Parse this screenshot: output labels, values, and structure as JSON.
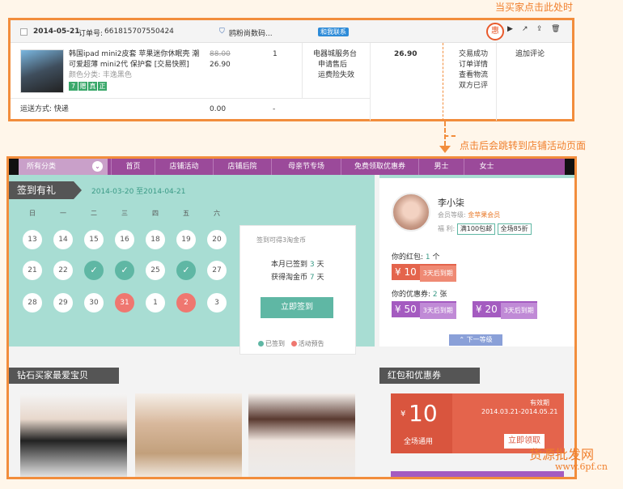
{
  "annotation_top": "当买家点击此处时",
  "annotation_mid": "点击后会跳转到店铺活动页面",
  "order": {
    "date": "2014-05-21",
    "order_no_label": "订单号:",
    "order_no": "661815707550424",
    "shop_name": "鸥粉尚数码...",
    "contact_label": "和我联系",
    "promo_icon_label": "惠",
    "product_title_lines": [
      "韩国ipad mini2皮套 苹果迷你休眠壳 潮",
      "可爱超薄 mini2代 保护套 [交易快照]"
    ],
    "color_label": "颜色分类: 丰逸黑色",
    "badges": [
      "7",
      "赠",
      "真",
      "正"
    ],
    "price_original": "88.00",
    "price_now": "26.90",
    "quantity": "1",
    "service_lines": [
      "电器城服务台",
      "申请售后",
      "运费险失效"
    ],
    "total": "26.90",
    "status_lines": [
      "交易成功",
      "订单详情",
      "查看物流",
      "双方已评"
    ],
    "action_label": "追加评论",
    "shipping_label": "运送方式: 快递",
    "shipping_fee": "0.00",
    "shipping_dash": "-"
  },
  "shop": {
    "nav": {
      "category_label": "所有分类",
      "items": [
        "首页",
        "店铺活动",
        "店铺后院",
        "母亲节专场",
        "免费领取优惠券",
        "男士",
        "女士"
      ]
    },
    "sign": {
      "title": "签到有礼",
      "date_range": "2014-03-20 至2014-04-21",
      "weekdays": [
        "日",
        "一",
        "二",
        "三",
        "四",
        "五",
        "六"
      ],
      "days_row1": [
        "13",
        "14",
        "15",
        "16",
        "18",
        "19",
        "20"
      ],
      "days_row2": [
        "21",
        "22",
        "✓",
        "✓",
        "25",
        "✓",
        "27"
      ],
      "days_row3": [
        "28",
        "29",
        "30",
        "31",
        "1",
        "2",
        "3"
      ],
      "card_title": "签到可得3淘金币",
      "signed_label": "本月已签到",
      "signed_count": "3",
      "signed_unit": "天",
      "earned_label": "获得淘金币",
      "earned_count": "7",
      "earned_unit": "天",
      "button": "立即签到",
      "legend_signed": "已签到",
      "legend_preview": "活动预告"
    },
    "user": {
      "name": "李小柒",
      "level_label": "会员等级:",
      "level": "金苹果会员",
      "benefit_label": "福 利:",
      "benefits": [
        "满100包邮",
        "全场85折"
      ],
      "hongbao_label": "你的红包:",
      "hongbao_count": "1",
      "hongbao_unit": "个",
      "coupon_label": "你的优惠券:",
      "coupon_count": "2",
      "coupon_unit": "张",
      "coupon_red_amount": "¥ 10",
      "coupon_red_text": "3天后到期",
      "coupon1_amount": "¥ 50",
      "coupon1_text": "3天后到期",
      "coupon2_amount": "¥ 20",
      "coupon2_text": "3天后到期",
      "next_level": "⌃ 下一等级"
    },
    "favorites_title": "钻石买家最爱宝贝",
    "redpack_title": "红包和优惠券",
    "redpack": {
      "amount": "10",
      "currency": "¥",
      "scope": "全场通用",
      "validity_label": "有效期",
      "validity": "2014.03.21-2014.05.21",
      "button": "立即领取"
    }
  },
  "watermark_cn": "货源批发网",
  "watermark_url": "www.6pf.cn"
}
